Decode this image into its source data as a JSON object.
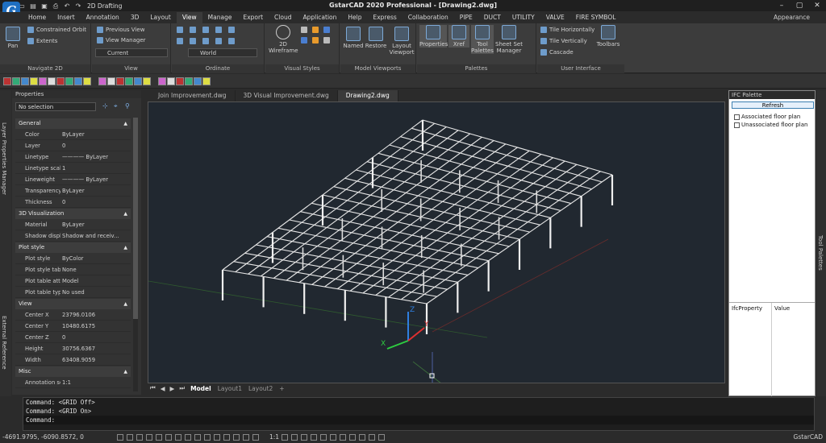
{
  "window": {
    "title": "GstarCAD 2020 Professional - [Drawing2.dwg]",
    "workspace": "2D Drafting",
    "logo_letter": "G"
  },
  "menu": {
    "items": [
      "Home",
      "Insert",
      "Annotation",
      "3D",
      "Layout",
      "View",
      "Manage",
      "Export",
      "Cloud",
      "Application",
      "Help",
      "Express",
      "Collaboration",
      "PIPE",
      "DUCT",
      "UTILITY",
      "VALVE",
      "FIRE SYMBOL"
    ],
    "active": "View",
    "appearance": "Appearance"
  },
  "ribbon": {
    "navigate": {
      "title": "Navigate 2D",
      "pan": "Pan",
      "constrained_orbit": "Constrained Orbit",
      "extents": "Extents"
    },
    "view": {
      "title": "View",
      "previous_view": "Previous View",
      "view_manager": "View Manager",
      "current": "Current"
    },
    "ordinate": {
      "title": "Ordinate",
      "world": "World"
    },
    "visual_styles": {
      "title": "Visual Styles",
      "wireframe": "2D Wireframe"
    },
    "model_viewports": {
      "title": "Model Viewports",
      "named": "Named",
      "restore": "Restore",
      "layout_viewport": "Layout Viewport"
    },
    "palettes": {
      "title": "Palettes",
      "properties": "Properties",
      "xref": "Xref",
      "tool_palettes": "Tool Palettes",
      "sheet_set": "Sheet Set Manager"
    },
    "ui": {
      "title": "User Interface",
      "tile_h": "Tile Horizontally",
      "tile_v": "Tile Vertically",
      "cascade": "Cascade",
      "toolbars": "Toolbars"
    }
  },
  "left_strip": {
    "layer_props": "Layer Properties Manager",
    "external_ref": "External Reference"
  },
  "properties": {
    "title": "Properties",
    "selection": "No selection",
    "sections": [
      {
        "name": "General",
        "rows": [
          [
            "Color",
            "ByLayer"
          ],
          [
            "Layer",
            "0"
          ],
          [
            "Linetype",
            "———— ByLayer"
          ],
          [
            "Linetype scale",
            "1"
          ],
          [
            "Lineweight",
            "———— ByLayer"
          ],
          [
            "Transparency",
            "ByLayer"
          ],
          [
            "Thickness",
            "0"
          ]
        ]
      },
      {
        "name": "3D Visualization",
        "rows": [
          [
            "Material",
            "ByLayer"
          ],
          [
            "Shadow display",
            "Shadow and receiv..."
          ]
        ]
      },
      {
        "name": "Plot style",
        "rows": [
          [
            "Plot style",
            "ByColor"
          ],
          [
            "Plot style table",
            "None"
          ],
          [
            "Plot table attac...",
            "Model"
          ],
          [
            "Plot table type",
            "No used"
          ]
        ]
      },
      {
        "name": "View",
        "rows": [
          [
            "Center X",
            "23796.0106"
          ],
          [
            "Center Y",
            "10480.6175"
          ],
          [
            "Center Z",
            "0"
          ],
          [
            "Height",
            "30756.6367"
          ],
          [
            "Width",
            "63408.9059"
          ]
        ]
      },
      {
        "name": "Misc",
        "rows": [
          [
            "Annotation scale",
            "1:1"
          ]
        ]
      }
    ]
  },
  "doc_tabs": [
    "Join Improvement.dwg",
    "3D Visual Improvement.dwg",
    "Drawing2.dwg"
  ],
  "active_tab": "Drawing2.dwg",
  "layouts": {
    "items": [
      "Model",
      "Layout1",
      "Layout2",
      "+"
    ],
    "active": "Model"
  },
  "ucs": {
    "x": "X",
    "y": "Y",
    "z": "Z"
  },
  "ifc": {
    "title": "IFC Palette",
    "refresh": "Refresh",
    "items": [
      "Associated floor plan",
      "Unassociated floor plan"
    ],
    "col_property": "IfcProperty",
    "col_value": "Value"
  },
  "right_strip": {
    "tool_palettes": "Tool Palettes"
  },
  "command": {
    "lines": [
      "Command: <GRID Off>",
      "Command: <GRID On>",
      "Command:"
    ]
  },
  "status": {
    "coords": "-4691.9795, -6090.8572, 0",
    "scale": "1:1",
    "app": "GstarCAD"
  },
  "colors": {
    "canvas": "#212830",
    "accent": "#1f6fc1"
  }
}
